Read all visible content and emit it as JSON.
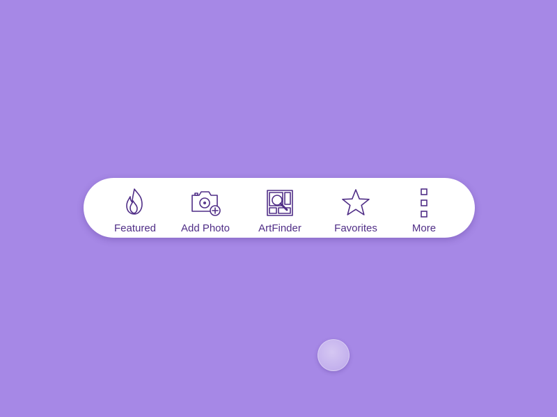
{
  "colors": {
    "background": "#a688e6",
    "bar": "#ffffff",
    "accent": "#4f2d86"
  },
  "tab_bar": {
    "tabs": [
      {
        "label": "Featured",
        "icon": "flame-icon"
      },
      {
        "label": "Add Photo",
        "icon": "camera-add-icon"
      },
      {
        "label": "ArtFinder",
        "icon": "artfinder-search-icon"
      },
      {
        "label": "Favorites",
        "icon": "star-icon"
      },
      {
        "label": "More",
        "icon": "more-vertical-icon"
      }
    ]
  }
}
